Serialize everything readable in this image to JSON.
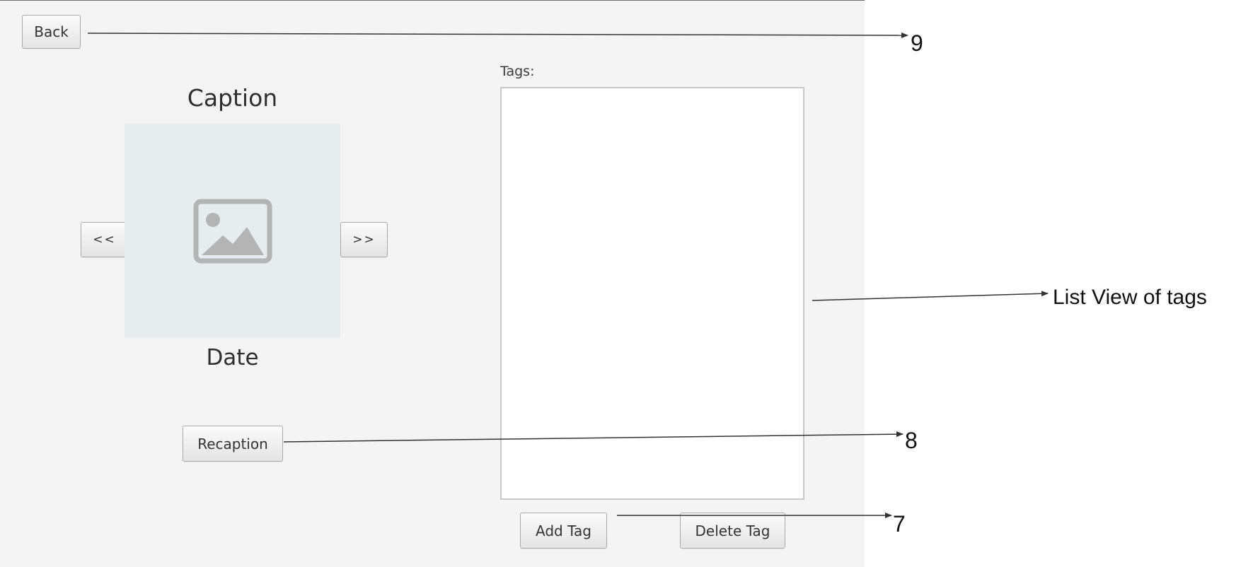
{
  "window": {
    "back_label": "Back",
    "prev_label": "<<",
    "next_label": ">>",
    "caption": "Caption",
    "date": "Date",
    "recaption_label": "Recaption",
    "tags_label": "Tags:",
    "tags": [],
    "add_tag_label": "Add Tag",
    "delete_tag_label": "Delete Tag"
  },
  "annotations": {
    "back": "9",
    "recaption": "8",
    "add_tag": "7",
    "list_view": "List View of tags"
  },
  "icons": {
    "image_placeholder": "image-placeholder-icon"
  },
  "colors": {
    "window_bg": "#f4f4f4",
    "image_bg": "#e7ecef",
    "icon_gray": "#b4b4b4",
    "annotation": "#111111"
  }
}
